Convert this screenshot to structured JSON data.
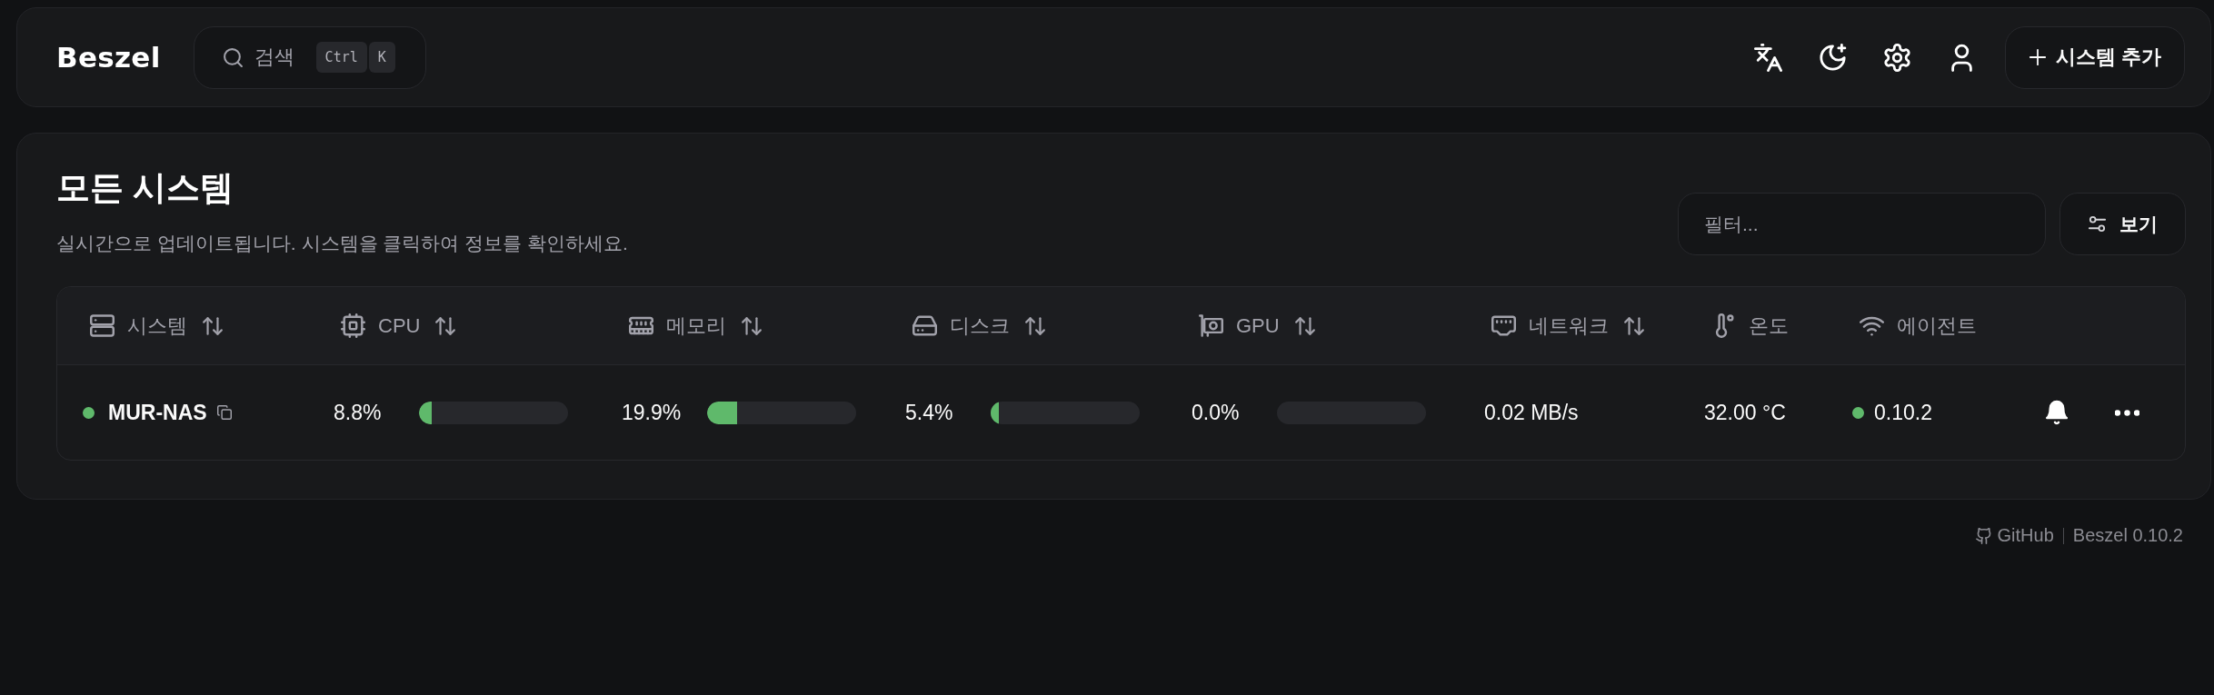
{
  "header": {
    "logo": "Beszel",
    "search": {
      "label": "검색",
      "shortcut": [
        "Ctrl",
        "K"
      ]
    },
    "add_button": "시스템 추가"
  },
  "systems": {
    "title": "모든 시스템",
    "subtitle": "실시간으로 업데이트됩니다. 시스템을 클릭하여 정보를 확인하세요.",
    "filter": {
      "placeholder": "필터..."
    },
    "view_button": "보기"
  },
  "table": {
    "columns": [
      {
        "label": "시스템",
        "sortable": true
      },
      {
        "label": "CPU",
        "sortable": true
      },
      {
        "label": "메모리",
        "sortable": true
      },
      {
        "label": "디스크",
        "sortable": true
      },
      {
        "label": "GPU",
        "sortable": true
      },
      {
        "label": "네트워크",
        "sortable": true
      },
      {
        "label": "온도",
        "sortable": false
      },
      {
        "label": "에이전트",
        "sortable": false
      }
    ],
    "rows": [
      {
        "online": true,
        "name": "MUR-NAS",
        "cpu": {
          "reading": "8.8%",
          "level": 0.088
        },
        "memory": {
          "reading": "19.9%",
          "level": 0.199
        },
        "disk": {
          "reading": "5.4%",
          "level": 0.054
        },
        "gpu": {
          "reading": "0.0%"
        },
        "network": "0.02 MB/s",
        "temperature": "32.00 °C",
        "agent": {
          "online": true,
          "version": "0.10.2"
        }
      }
    ]
  },
  "footer": {
    "link": "GitHub",
    "version": "Beszel 0.10.2"
  }
}
